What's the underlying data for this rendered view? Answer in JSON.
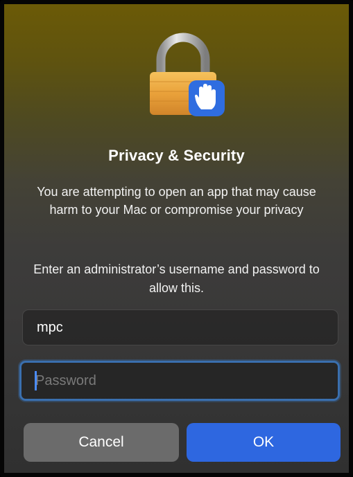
{
  "dialog": {
    "title": "Privacy & Security",
    "message": "You are attempting to open an app that may cause harm to your Mac or compromise your privacy",
    "instruction": "Enter an administrator’s username and password to allow this."
  },
  "form": {
    "username_value": "mpc",
    "password_placeholder": "Password"
  },
  "buttons": {
    "cancel_label": "Cancel",
    "ok_label": "OK"
  },
  "icons": {
    "main": "padlock-icon",
    "badge": "raised-hand-icon"
  },
  "colors": {
    "ok_button": "#2e67e0",
    "cancel_button": "#6b6b6b",
    "focus_ring": "#3a6fae",
    "lock_body": "#e8a23c",
    "hand_badge": "#2f6de0"
  }
}
